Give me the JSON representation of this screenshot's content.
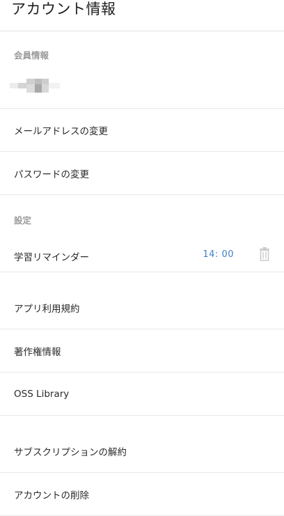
{
  "header": {
    "title": "アカウント情報"
  },
  "member": {
    "section_label": "会員情報"
  },
  "menu_top": [
    {
      "label": "メールアドレスの変更"
    },
    {
      "label": "パスワードの変更"
    }
  ],
  "settings": {
    "section_label": "設定",
    "reminder_label": "学習リマインダー",
    "reminder_time": "14: 00"
  },
  "menu_info": [
    {
      "label": "アプリ利用規約"
    },
    {
      "label": "著作権情報"
    },
    {
      "label": "OSS Library"
    }
  ],
  "menu_account": [
    {
      "label": "サブスクリプションの解約"
    },
    {
      "label": "アカウントの削除"
    }
  ],
  "colors": {
    "accent_time": "#3f7fc6",
    "section_label": "#9a9a9a",
    "divider": "#e8e8e8"
  }
}
